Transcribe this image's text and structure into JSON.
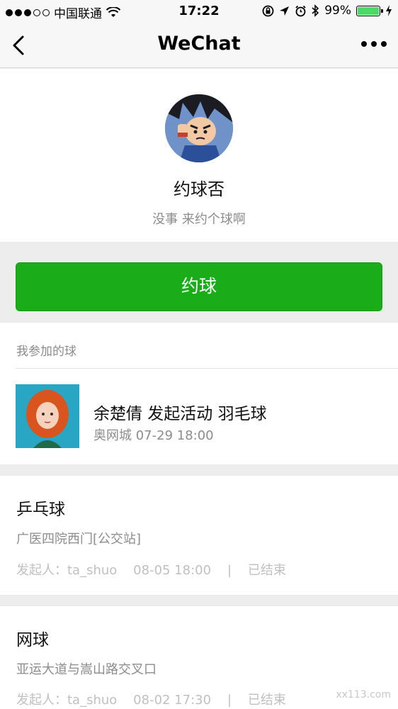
{
  "status_bar": {
    "carrier": "中国联通",
    "time": "17:22",
    "battery_percent": "99%",
    "battery_level": 0.99,
    "signal_bars": 5,
    "signal_filled": 3,
    "icons": [
      "wifi-icon",
      "rotation-lock-icon",
      "location-icon",
      "alarm-icon",
      "bluetooth-icon",
      "battery-icon",
      "charging-icon"
    ]
  },
  "nav": {
    "title": "WeChat",
    "back_icon": "chevron-left-icon",
    "more_icon": "more-dots-icon"
  },
  "profile": {
    "name": "约球否",
    "subtitle": "没事 来约个球啊"
  },
  "primary_button": {
    "label": "约球",
    "color": "#1aad19"
  },
  "joined_section": {
    "header": "我参加的球",
    "items": [
      {
        "title": "余楚倩 发起活动 羽毛球",
        "meta": "奥网城 07-29 18:00"
      }
    ]
  },
  "activities": [
    {
      "title": "乒乓球",
      "location": "广医四院西门[公交站]",
      "meta": "发起人：ta_shuo    08-05 18:00    |    已结束"
    },
    {
      "title": "网球",
      "location": "亚运大道与嵩山路交叉口",
      "meta": "发起人：ta_shuo    08-02 17:30    |    已结束"
    }
  ],
  "watermark": "xx113.com"
}
